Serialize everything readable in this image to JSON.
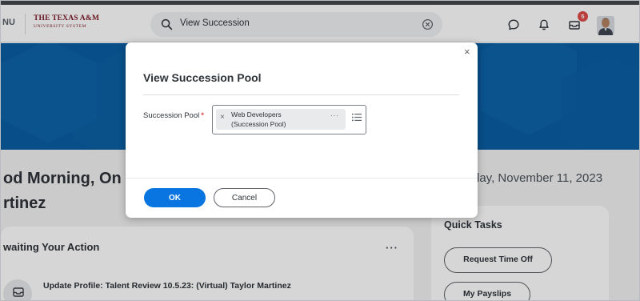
{
  "header": {
    "menu_label": "NU",
    "logo_main": "THE TEXAS A&M",
    "logo_sub": "UNIVERSITY SYSTEM",
    "search_value": "View Succession",
    "notification_count": "5"
  },
  "page": {
    "greeting_line1": "od Morning, On",
    "greeting_line2": "rtinez",
    "date": "day, November 11, 2023"
  },
  "awaiting": {
    "title": "waiting Your Action",
    "more": "···",
    "item_title": "Update Profile: Talent Review 10.5.23: (Virtual) Taylor Martinez"
  },
  "quick_tasks": {
    "title": "Quick Tasks",
    "buttons": [
      "Request Time Off",
      "My Payslips"
    ]
  },
  "modal": {
    "title": "View Succession Pool",
    "close": "×",
    "field_label": "Succession Pool",
    "required_mark": "*",
    "selected_line1": "Web Developers",
    "selected_line2": "(Succession Pool)",
    "remove": "×",
    "more": "···",
    "ok_label": "OK",
    "cancel_label": "Cancel"
  },
  "colors": {
    "brand_maroon": "#7d1a28",
    "hero_blue": "#0a5ea3",
    "primary_button": "#0875e1",
    "badge_red": "#de4a4a"
  }
}
